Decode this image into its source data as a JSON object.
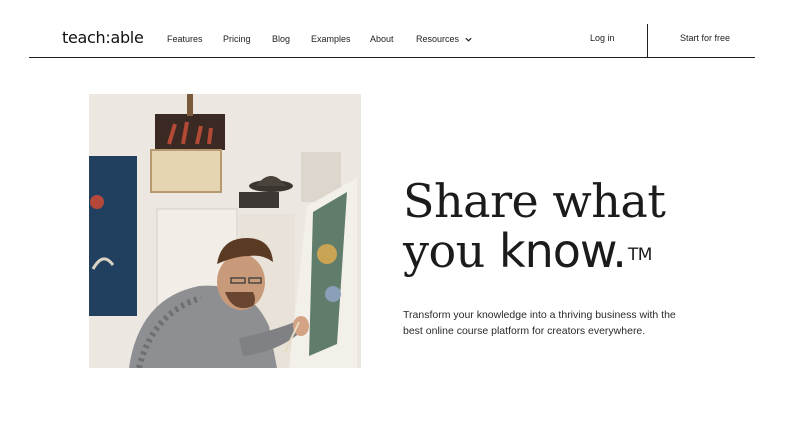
{
  "header": {
    "logo": "teach:able",
    "nav": [
      "Features",
      "Pricing",
      "Blog",
      "Examples",
      "About",
      "Resources"
    ],
    "login": "Log in",
    "cta": "Start for free"
  },
  "hero": {
    "headline_line1": "Share what",
    "headline_line2_light": "you ",
    "headline_line2_strong": "know.",
    "trademark": "TM",
    "subtitle": "Transform your knowledge into a thriving business with the best online course platform for creators everywhere."
  },
  "colors": {
    "text": "#1f1f1f",
    "background": "#ffffff",
    "divider": "#1f1f1f"
  },
  "icons": {
    "resources_dropdown": "chevron-down-icon"
  }
}
